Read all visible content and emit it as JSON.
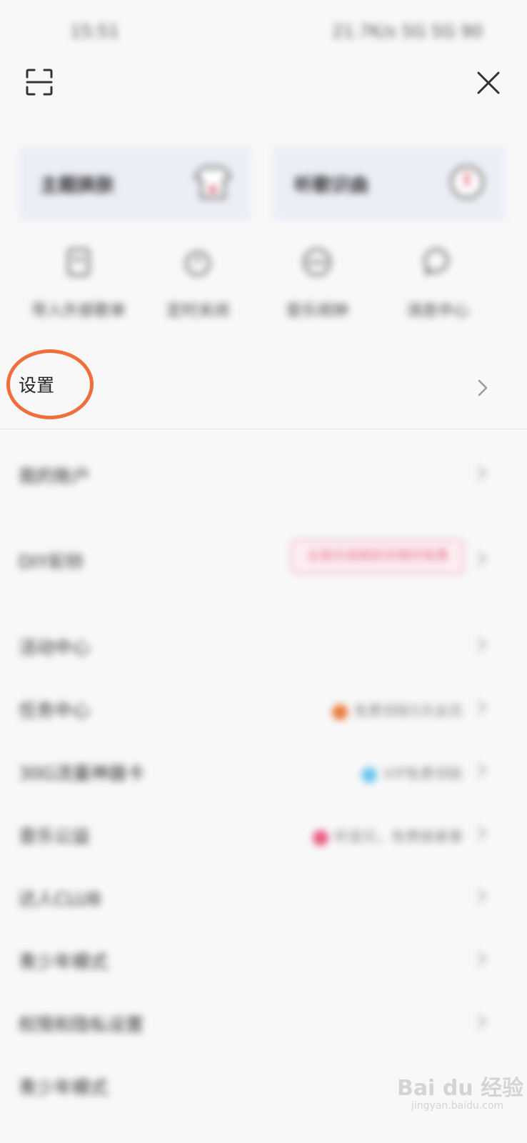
{
  "status_bar": {
    "time": "15:51",
    "indicators": "21.7K/s 5G 5G 90"
  },
  "header": {
    "scan_icon": "scan-icon",
    "close_icon": "close-icon"
  },
  "cards": [
    {
      "title": "主题换肤",
      "icon": "tshirt-icon"
    },
    {
      "title": "听歌识曲",
      "icon": "microphone-icon"
    }
  ],
  "shortcuts": [
    {
      "label": "导入外部歌单",
      "icon": "import-icon"
    },
    {
      "label": "定时关闭",
      "icon": "timer-icon"
    },
    {
      "label": "音乐闹钟",
      "icon": "alarm-icon"
    },
    {
      "label": "消息中心",
      "icon": "message-icon"
    }
  ],
  "settings": {
    "label": "设置"
  },
  "menu": [
    {
      "label": "我的账户",
      "note": ""
    },
    {
      "label": "DIY彩铃",
      "badge": "云音乐视频彩铃限时免费"
    },
    {
      "label": "活动中心",
      "note": ""
    },
    {
      "label": "任务中心",
      "note": "免费领取5天会员",
      "dot": "#ea7a3a"
    },
    {
      "label": "30G流量神器卡",
      "note": "VIP免费领取",
      "dot": "#6cc6ee"
    },
    {
      "label": "音乐公益",
      "note": "听音乐，免费做善事",
      "dot": "#ea5a7e"
    },
    {
      "label": "达人CLUB",
      "note": ""
    },
    {
      "label": "青少年模式",
      "note": ""
    },
    {
      "label": "权限和隐私设置",
      "note": ""
    },
    {
      "label": "青少年模式",
      "note": ""
    }
  ],
  "watermark": {
    "main": "Bai du 经验",
    "sub": "jingyan.baidu.com"
  },
  "colors": {
    "highlight": "#ee6f3c",
    "background": "#f8f8f9"
  }
}
